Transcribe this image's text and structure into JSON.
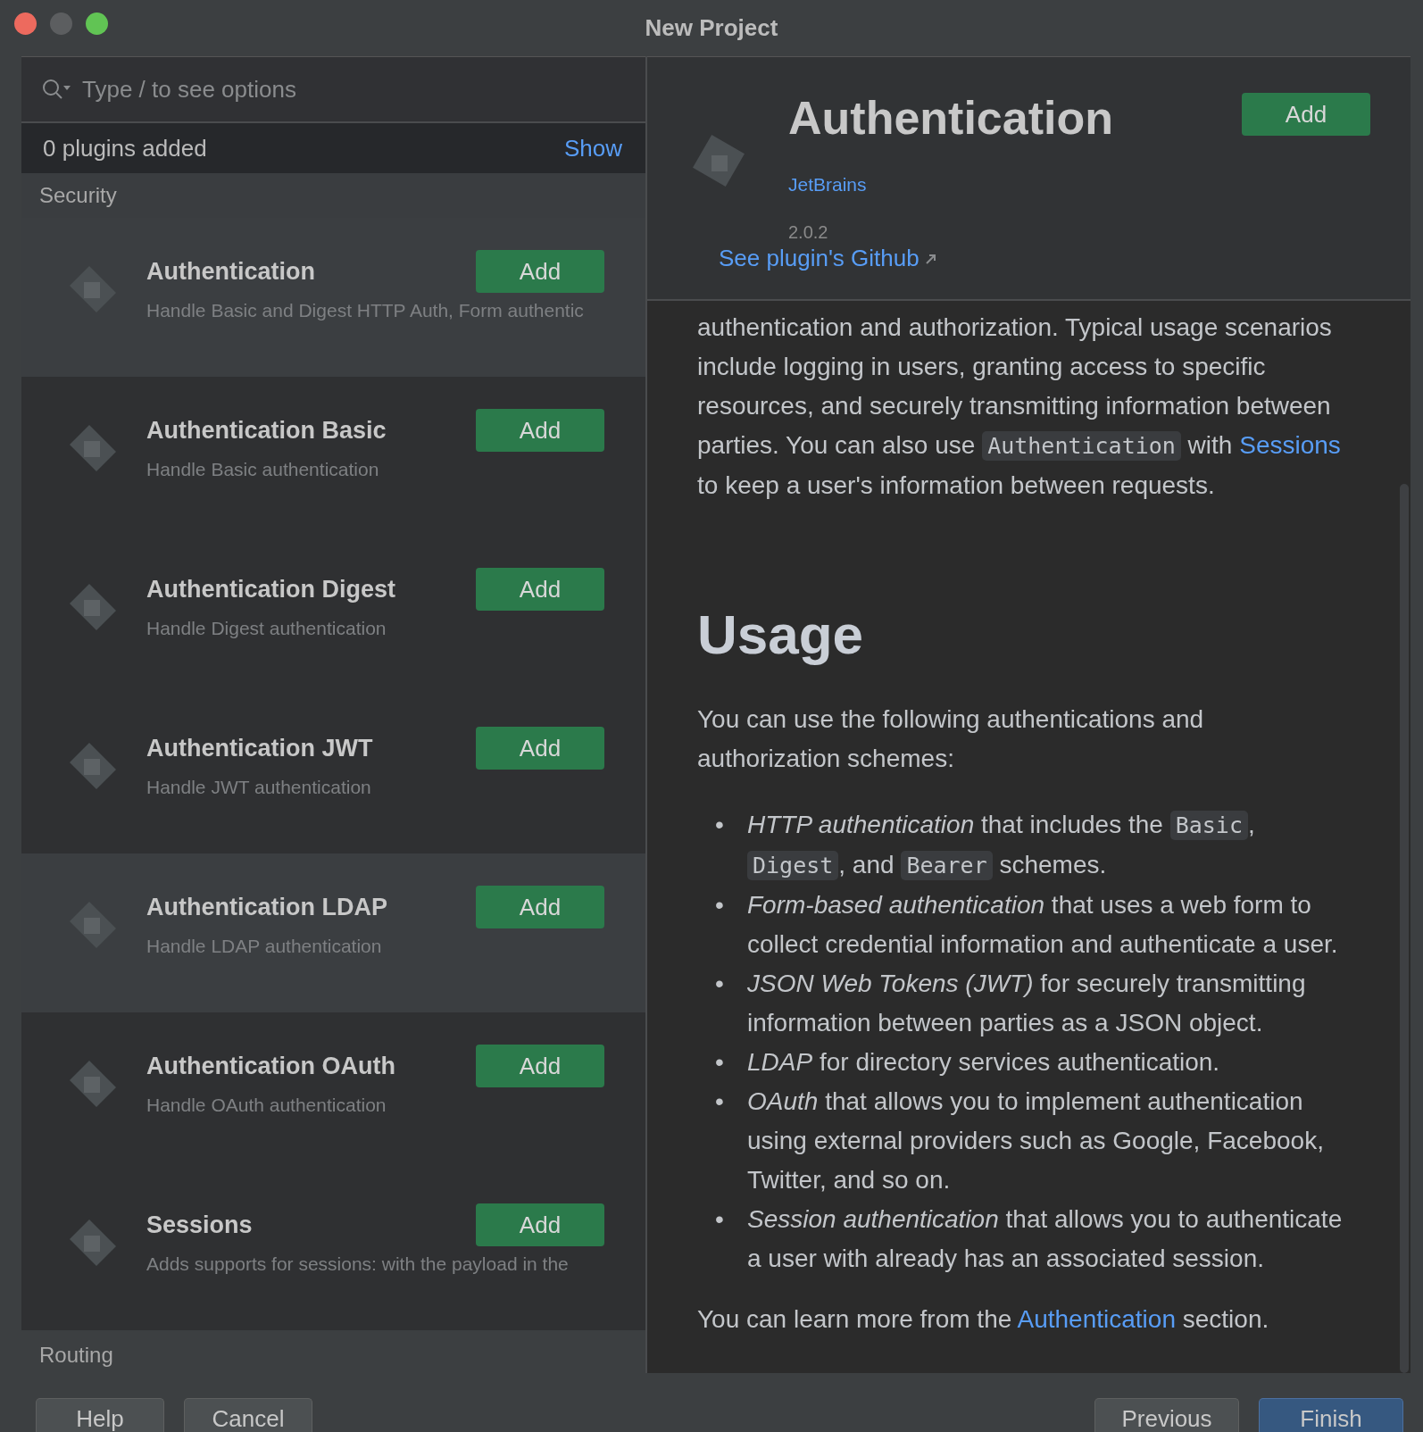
{
  "window": {
    "title": "New Project"
  },
  "search": {
    "placeholder": "Type / to see options"
  },
  "added_bar": {
    "count": "0 plugins added",
    "link": "Show"
  },
  "group_header": "Security",
  "plugins": [
    {
      "name": "Authentication",
      "description": "Handle Basic and Digest HTTP Auth, Form authentic",
      "button": "Add",
      "highlighted": true
    },
    {
      "name": "Authentication Basic",
      "description": "Handle Basic authentication",
      "button": "Add",
      "highlighted": false
    },
    {
      "name": "Authentication Digest",
      "description": "Handle Digest authentication",
      "button": "Add",
      "highlighted": false
    },
    {
      "name": "Authentication JWT",
      "description": "Handle JWT authentication",
      "button": "Add",
      "highlighted": false
    },
    {
      "name": "Authentication LDAP",
      "description": "Handle LDAP authentication",
      "button": "Add",
      "highlighted": true
    },
    {
      "name": "Authentication OAuth",
      "description": "Handle OAuth authentication",
      "button": "Add",
      "highlighted": false
    },
    {
      "name": "Sessions",
      "description": "Adds supports for sessions: with the payload in the",
      "button": "Add",
      "highlighted": false
    }
  ],
  "next_group_header": "Routing",
  "detail": {
    "title": "Authentication",
    "button": "Add",
    "vendor": "JetBrains",
    "version": "2.0.2",
    "github_link": "See plugin's Github",
    "content": [
      {
        "kind": "paragraph",
        "parts": [
          {
            "kind": "text",
            "text": "authentication and authorization. Typical usage scenarios include logging in users, granting access to specific resources, and securely transmitting information between parties. You can also use "
          },
          {
            "kind": "code",
            "text": "Authentication"
          },
          {
            "kind": "text",
            "text": " with "
          },
          {
            "kind": "link",
            "text": "Sessions"
          },
          {
            "kind": "text",
            "text": " to keep a user's information between requests."
          }
        ]
      },
      {
        "kind": "heading",
        "text": "Usage"
      },
      {
        "kind": "paragraph",
        "parts": [
          {
            "kind": "text",
            "text": "You can use the following authentications and authorization schemes:"
          }
        ]
      },
      {
        "kind": "list",
        "bullet": "•",
        "items": [
          [
            {
              "kind": "text",
              "text": "*HTTP authentication* that includes the "
            },
            {
              "kind": "code",
              "text": "Basic"
            },
            {
              "kind": "text",
              "text": ", "
            },
            {
              "kind": "code",
              "text": "Digest"
            },
            {
              "kind": "text",
              "text": ", and "
            },
            {
              "kind": "code",
              "text": "Bearer"
            },
            {
              "kind": "text",
              "text": " schemes."
            }
          ],
          [
            {
              "kind": "text",
              "text": "*Form-based authentication* that uses a web form to collect credential information and authenticate a user."
            }
          ],
          [
            {
              "kind": "text",
              "text": "*JSON Web Tokens (JWT)* for securely transmitting information between parties as a JSON object."
            }
          ],
          [
            {
              "kind": "text",
              "text": "*LDAP* for directory services authentication."
            }
          ],
          [
            {
              "kind": "text",
              "text": "*OAuth* that allows you to implement authentication using external providers such as Google, Facebook, Twitter, and so on."
            }
          ],
          [
            {
              "kind": "text",
              "text": "*Session authentication* that allows you to authenticate a user with already has an associated session."
            }
          ]
        ]
      },
      {
        "kind": "paragraph",
        "parts": [
          {
            "kind": "text",
            "text": "You can learn more from the "
          },
          {
            "kind": "link",
            "text": "Authentication"
          },
          {
            "kind": "text",
            "text": " section."
          }
        ]
      }
    ]
  },
  "footer": {
    "left_buttons": [
      "Help",
      "Cancel"
    ],
    "right_buttons": [
      {
        "label": "Previous",
        "primary": false
      },
      {
        "label": "Finish",
        "primary": true
      }
    ]
  }
}
